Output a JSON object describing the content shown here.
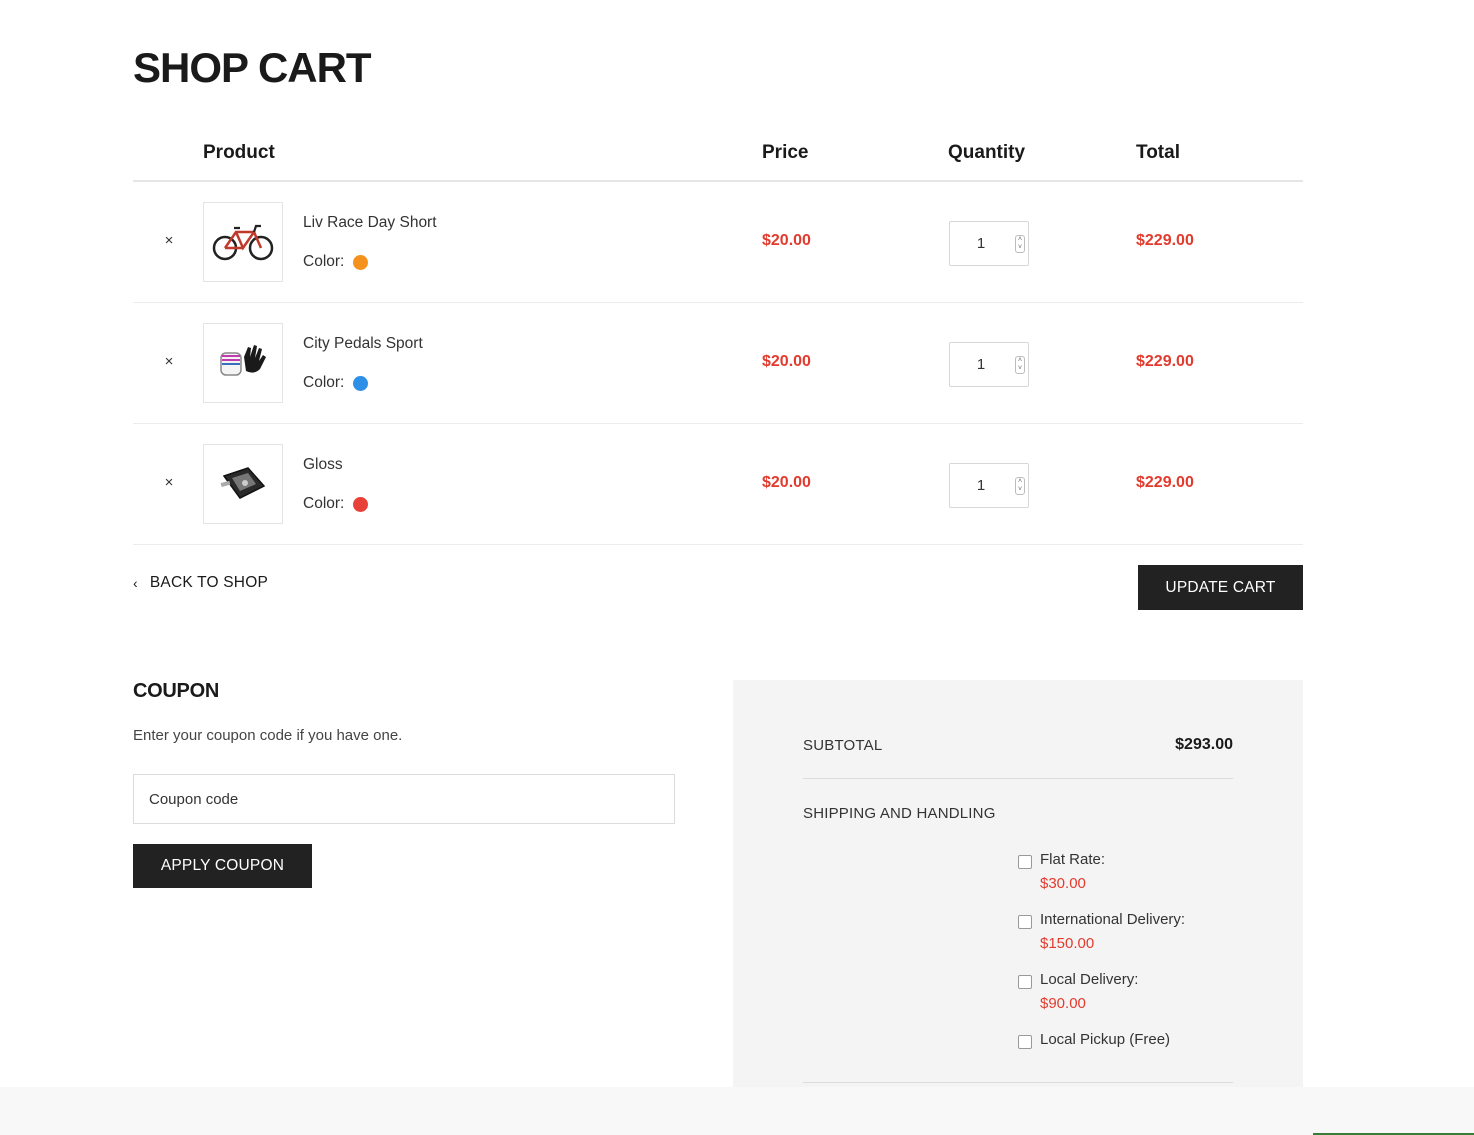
{
  "page": {
    "title": "SHOP CART"
  },
  "table": {
    "headers": {
      "product": "Product",
      "price": "Price",
      "quantity": "Quantity",
      "total": "Total"
    },
    "remove_glyph": "×",
    "rows": [
      {
        "name": "Liv Race Day Short",
        "color_label": "Color:",
        "color": "#f5921e",
        "icon": "bicycle-icon",
        "price": "$20.00",
        "quantity": "1",
        "total": "$229.00"
      },
      {
        "name": "City Pedals Sport",
        "color_label": "Color:",
        "color": "#2e8fe6",
        "icon": "gloves-icon",
        "price": "$20.00",
        "quantity": "1",
        "total": "$229.00"
      },
      {
        "name": "Gloss",
        "color_label": "Color:",
        "color": "#e8413a",
        "icon": "pedal-icon",
        "price": "$20.00",
        "quantity": "1",
        "total": "$229.00"
      }
    ]
  },
  "actions": {
    "back_to_shop": "BACK TO SHOP",
    "update_cart": "UPDATE CART"
  },
  "coupon": {
    "title": "COUPON",
    "description": "Enter your coupon code if you have one.",
    "placeholder": "Coupon code",
    "apply_label": "APPLY COUPON"
  },
  "totals": {
    "subtotal_label": "SUBTOTAL",
    "subtotal_value": "$293.00",
    "shipping_label": "SHIPPING AND HANDLING",
    "shipping_options": [
      {
        "label": "Flat Rate:",
        "price": "$30.00",
        "checked": false
      },
      {
        "label": "International Delivery:",
        "price": "$150.00",
        "checked": false
      },
      {
        "label": "Local Delivery:",
        "price": "$90.00",
        "checked": false
      },
      {
        "label": "Local Pickup (Free)",
        "price": "",
        "checked": false
      }
    ]
  },
  "colors": {
    "accent_price": "#e23b2e",
    "button_bg": "#222222",
    "totals_bg": "#f4f4f4"
  }
}
